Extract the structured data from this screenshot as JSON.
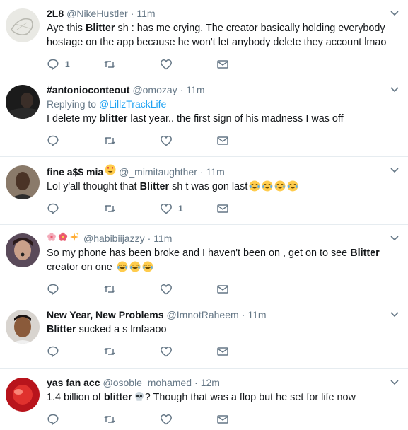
{
  "tweets": [
    {
      "name": "2L8",
      "handle": "@NikeHustler",
      "time": "11m",
      "text_parts": [
        "Aye this ",
        "Blitter",
        " sh  : has me crying. The creator basically holding everybody hostage on the app because he won't let anybody delete they account lmao"
      ],
      "reply_count": "1",
      "like_count": ""
    },
    {
      "name": "#antonioconteout",
      "handle": "@omozay",
      "time": "11m",
      "replying_prefix": "Replying to ",
      "replying_to": "@LillzTrackLife",
      "text_parts": [
        "I delete my ",
        "blitter",
        " last year.. the first sign of his madness I was off"
      ],
      "reply_count": "",
      "like_count": ""
    },
    {
      "name": "fine a$$ mia",
      "handle": "@_mimitaughther",
      "time": "11m",
      "text_parts": [
        "Lol y'all thought that ",
        "Blitter",
        " sh  t was gon last"
      ],
      "reply_count": "",
      "like_count": "1"
    },
    {
      "name": "",
      "handle": "@habibiijazzy",
      "time": "11m",
      "text_parts": [
        "So my phone has been broke and I haven't been on , get on to see ",
        "Blitter",
        " creator on one "
      ],
      "reply_count": "",
      "like_count": ""
    },
    {
      "name": "New Year, New Problems",
      "handle": "@ImnotRaheem",
      "time": "11m",
      "text_parts": [
        "",
        "Blitter",
        " sucked a  s lmfaaoo"
      ],
      "reply_count": "",
      "like_count": ""
    },
    {
      "name": "yas fan acc",
      "handle": "@osoble_mohamed",
      "time": "12m",
      "text_parts": [
        "1.4 billion of ",
        "blitter",
        "? Though that was a flop but he set for life now"
      ],
      "reply_count": "",
      "like_count": ""
    }
  ],
  "colors": {
    "text": "#14171a",
    "secondary": "#657786",
    "link": "#1da1f2",
    "divider": "#e6ecf0",
    "emoji_face": "#ffcc4d"
  }
}
